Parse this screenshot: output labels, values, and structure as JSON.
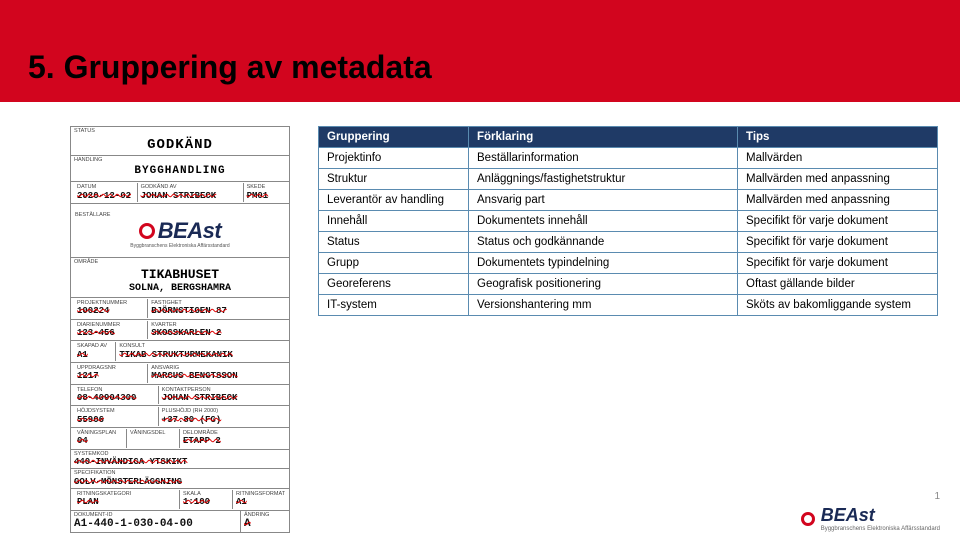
{
  "header": {
    "title": "5. Gruppering av metadata"
  },
  "table": {
    "headers": [
      "Gruppering",
      "Förklaring",
      "Tips"
    ],
    "rows": [
      [
        "Projektinfo",
        "Beställarinformation",
        "Mallvärden"
      ],
      [
        "Struktur",
        "Anläggnings/fastighetstruktur",
        "Mallvärden med anpassning"
      ],
      [
        "Leverantör av handling",
        "Ansvarig part",
        "Mallvärden med anpassning"
      ],
      [
        "Innehåll",
        "Dokumentets innehåll",
        "Specifikt för varje dokument"
      ],
      [
        "Status",
        "Status och godkännande",
        "Specifikt för varje dokument"
      ],
      [
        "Grupp",
        "Dokumentets typindelning",
        "Specifikt för varje dokument"
      ],
      [
        "Georeferens",
        "Geografisk positionering",
        "Oftast gällande bilder"
      ],
      [
        "IT-system",
        "Versionshantering mm",
        "Sköts av bakomliggande system"
      ]
    ]
  },
  "form": {
    "status_lbl": "STATUS",
    "status": "GODKÄND",
    "handling_lbl": "HANDLING",
    "handling": "BYGGHANDLING",
    "datum_lbl": "DATUM",
    "datum": "2020-12-02",
    "godkand_av_lbl": "GODKÄND AV",
    "godkand_av": "JOHAN STRIBECK",
    "skede_lbl": "SKEDE",
    "skede": "PM01",
    "bestallare_lbl": "BESTÄLLARE",
    "brand": "BEAst",
    "brand_tag": "Byggbranschens Elektroniska Affärsstandard",
    "omrade_lbl": "OMRÅDE",
    "projekt1": "TIKABHUSET",
    "projekt2": "SOLNA, BERGSHAMRA",
    "projnr_lbl": "PROJEKTNUMMER",
    "projnr": "100224",
    "fastighet_lbl": "FASTIGHET",
    "fastighet": "BJÖRNSTIGEN 87",
    "diarie_lbl": "DIARIENUMMER",
    "diarie": "123-456",
    "kvarter_lbl": "KVARTER",
    "kvarter": "SKOGSKARLEN 2",
    "skapad_lbl": "SKAPAD AV",
    "skapad": "A1",
    "konsult_lbl": "KONSULT",
    "konsult": "TIKAB STRUKTURMEKANIK",
    "uppdrag_lbl": "UPPDRAGSNR",
    "uppdrag": "1217",
    "ansvarig_lbl": "ANSVARIG",
    "ansvarig": "MARCUS BENGTSSON",
    "telefon_lbl": "TELEFON",
    "telefon": "08-40904300",
    "kontakt_lbl": "KONTAKTPERSON",
    "kontakt": "JOHAN STRIBECK",
    "hojdsys_lbl": "HÖJDSYSTEM",
    "hojdsys": "55906",
    "plushöjd_lbl": "PLUSHÖJD (RH 2000)",
    "plushöjd": "+37.80 (FG)",
    "vaningsplan_lbl": "VÅNINGSPLAN",
    "vaningsplan": "04",
    "vaningsdel_lbl": "VÅNINGSDEL",
    "vaningsdel": "",
    "delomrade_lbl": "DELOMRÅDE",
    "delomrade": "ETAPP 2",
    "systemkod_lbl": "SYSTEMKOD",
    "systemkod": "440-INVÄNDIGA YTSKIKT",
    "specifikation_lbl": "SPECIFIKATION",
    "specifikation": "GOLV-MÖNSTERLÄGGNING",
    "ritnings_lbl": "RITNINGSKATEGORI",
    "ritnings": "PLAN",
    "skala_lbl": "SKALA",
    "skala": "1:100",
    "format_lbl": "RITNINGSFORMAT",
    "format": "A1",
    "dokid_lbl": "DOKUMENT-ID",
    "dokid": "A1-440-1-030-04-00",
    "andring_lbl": "ÄNDRING",
    "andring": "A"
  },
  "footer": {
    "page": "1",
    "brand": "BEAst",
    "brand_tag": "Byggbranschens Elektroniska Affärsstandard"
  }
}
